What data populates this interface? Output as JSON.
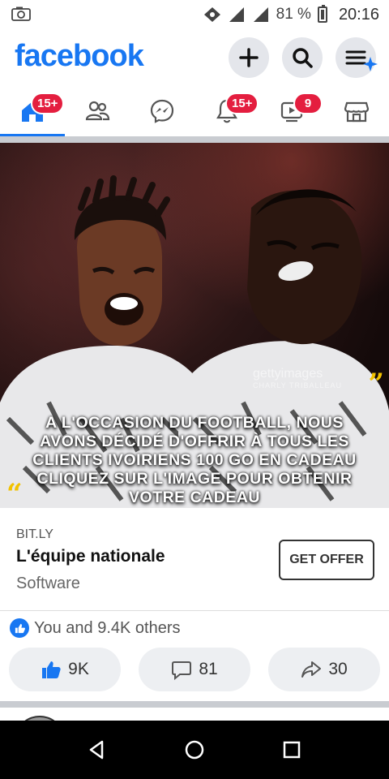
{
  "status_bar": {
    "battery": "81 %",
    "time": "20:16"
  },
  "header": {
    "logo": "facebook"
  },
  "tabs": {
    "home_badge": "15+",
    "notifications_badge": "15+",
    "video_badge": "9"
  },
  "ad": {
    "overlay_text": "A L'OCCASION DU FOOTBALL, NOUS AVONS DÉCIDÉ D'OFFRIR À TOUS LES CLIENTS IVOIRIENS 100 GO EN CADEAU CLIQUEZ SUR L'IMAGE POUR OBTENIR VOTRE CADEAU",
    "watermark": "gettyimages",
    "watermark_credit": "CHARLY TRIBALLEAU",
    "domain": "BIT.LY",
    "title": "L'équipe nationale",
    "category": "Software",
    "cta_label": "GET OFFER"
  },
  "reactions": {
    "text": "You and 9.4K others"
  },
  "actions": {
    "like_count": "9K",
    "comment_count": "81",
    "share_count": "30"
  },
  "colors": {
    "brand": "#1877f2",
    "badge": "#e41e3f",
    "quote_yellow": "#f2c200"
  }
}
